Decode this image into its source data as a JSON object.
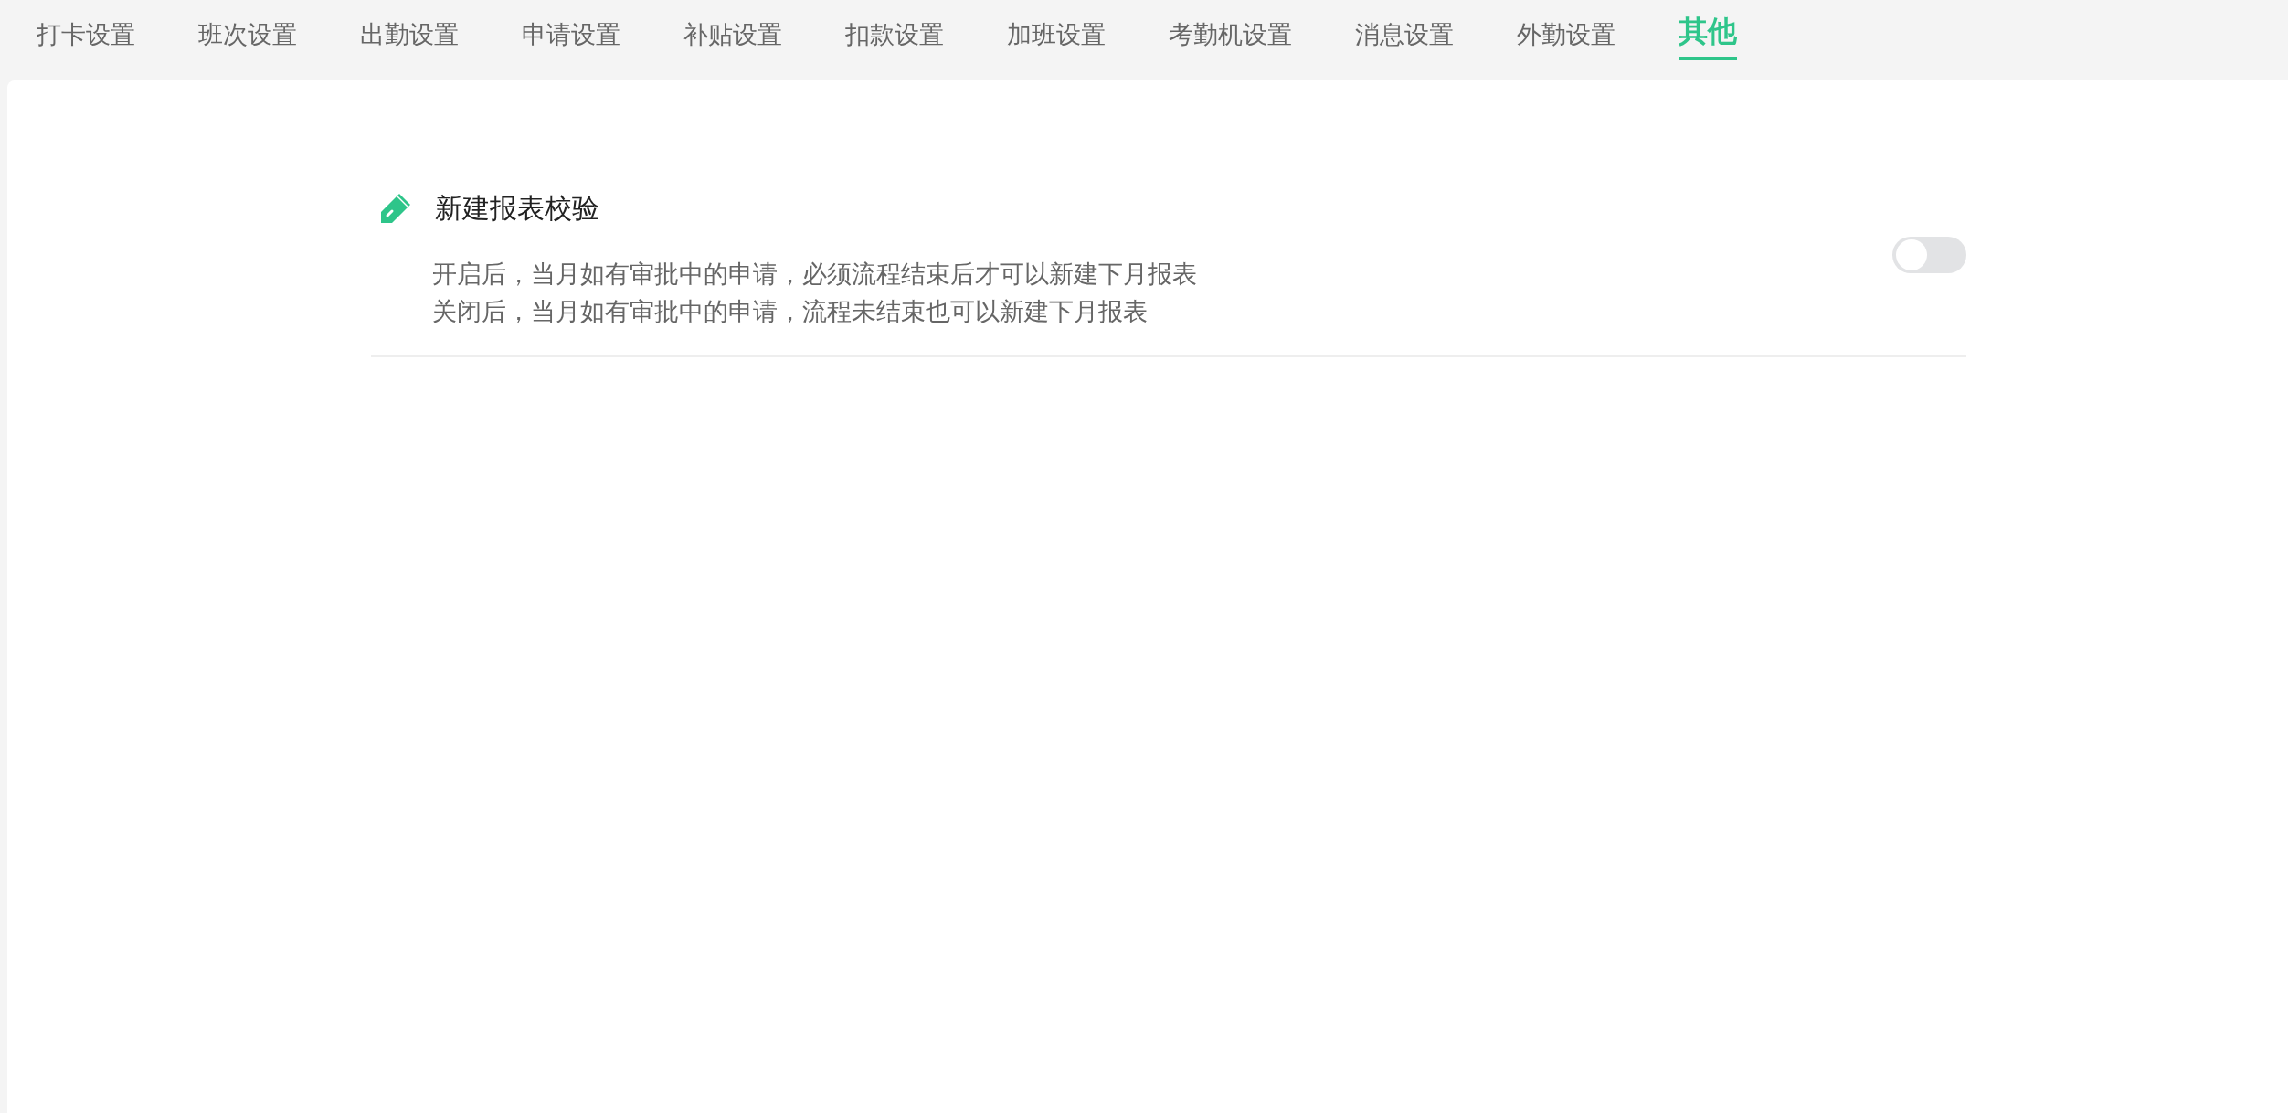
{
  "tabs": [
    {
      "label": "打卡设置",
      "selected": false
    },
    {
      "label": "班次设置",
      "selected": false
    },
    {
      "label": "出勤设置",
      "selected": false
    },
    {
      "label": "申请设置",
      "selected": false
    },
    {
      "label": "补贴设置",
      "selected": false
    },
    {
      "label": "扣款设置",
      "selected": false
    },
    {
      "label": "加班设置",
      "selected": false
    },
    {
      "label": "考勤机设置",
      "selected": false
    },
    {
      "label": "消息设置",
      "selected": false
    },
    {
      "label": "外勤设置",
      "selected": false
    },
    {
      "label": "其他",
      "selected": true
    }
  ],
  "settings": [
    {
      "title": "新建报表校验",
      "description": [
        "开启后，当月如有审批中的申请，必须流程结束后才可以新建下月报表",
        "关闭后，当月如有审批中的申请，流程未结束也可以新建下月报表"
      ],
      "on": false
    }
  ]
}
